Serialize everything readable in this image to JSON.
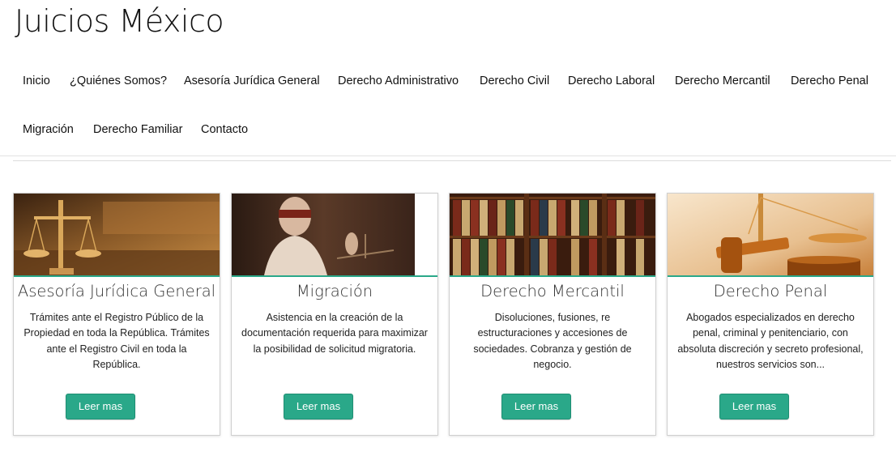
{
  "site": {
    "title": "Juicios México"
  },
  "nav": {
    "items": [
      "Inicio",
      "¿Quiénes Somos?",
      "Asesoría Jurídica General",
      "Derecho Administrativo",
      "Derecho Civil",
      "Derecho Laboral",
      "Derecho Mercantil",
      "Derecho Penal",
      "Migración",
      "Derecho Familiar",
      "Contacto"
    ]
  },
  "cards": [
    {
      "title": "Asesoría Jurídica General",
      "text": "Trámites ante el Registro Público de la Propiedad en toda la República. Trámites ante el Registro Civil en toda la República.",
      "button": "Leer mas",
      "image_icon": "courtroom-scales-image"
    },
    {
      "title": "Migración",
      "text": "Asistencia en la creación de la documentación requerida para maximizar la posibilidad de solicitud migratoria.",
      "button": "Leer mas",
      "image_icon": "blindfolded-justice-image"
    },
    {
      "title": "Derecho Mercantil",
      "text": "Disoluciones, fusiones, re estructuraciones y accesiones de sociedades. Cobranza y gestión de negocio.",
      "button": "Leer mas",
      "image_icon": "law-books-image"
    },
    {
      "title": "Derecho Penal",
      "text": "Abogados especializados en derecho penal, criminal y penitenciario, con absoluta discreción y secreto profesional, nuestros servicios son...",
      "button": "Leer mas",
      "image_icon": "gavel-scales-image"
    }
  ],
  "colors": {
    "accent": "#2aa889",
    "text": "#111111",
    "border": "#cfcfcf"
  }
}
